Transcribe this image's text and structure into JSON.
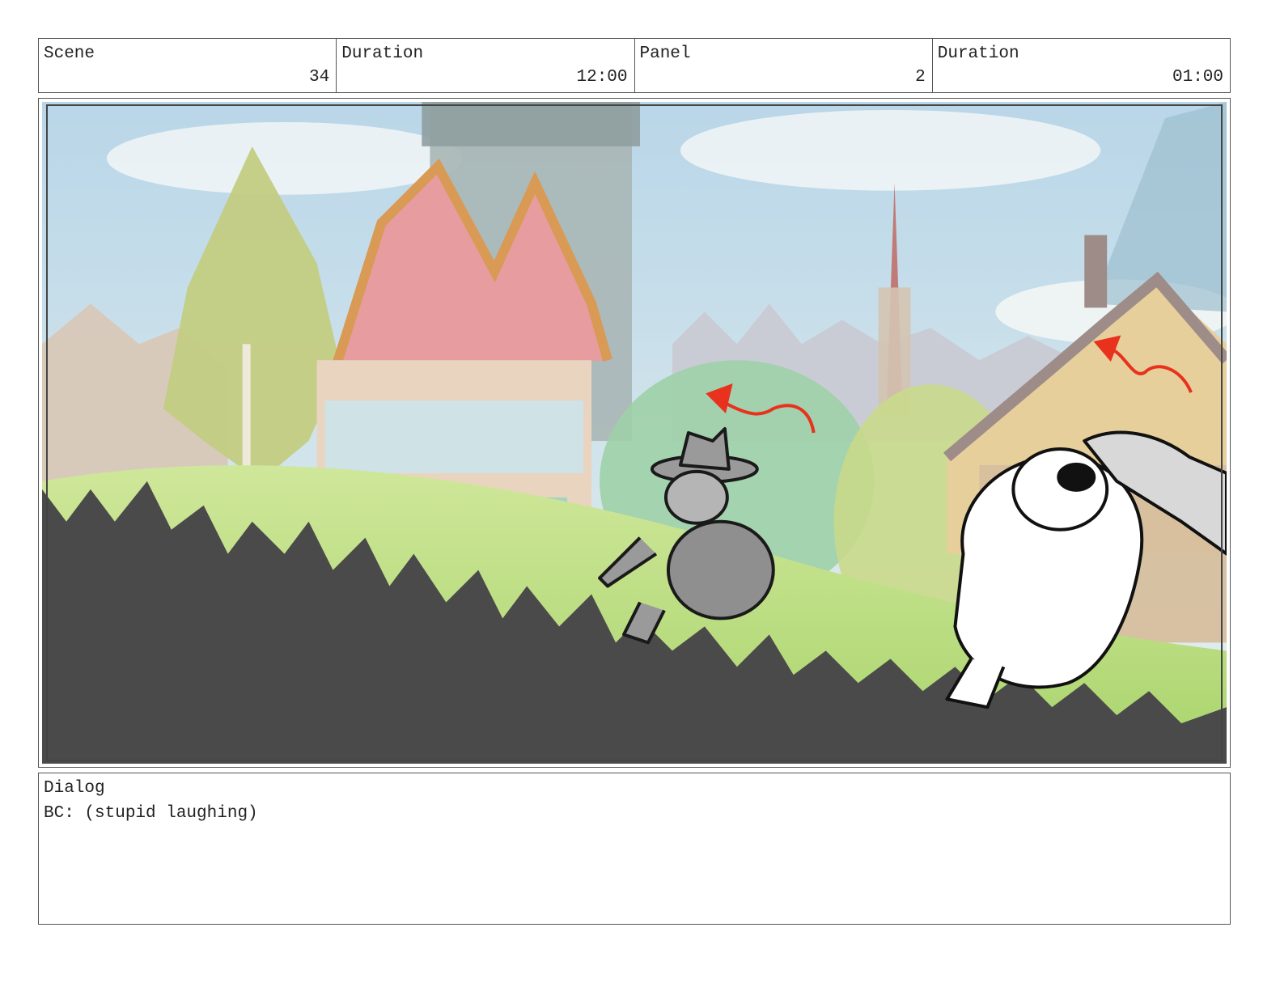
{
  "header": {
    "scene_label": "Scene",
    "scene_value": "34",
    "duration_label": "Duration",
    "duration_value": "12:00",
    "panel_label": "Panel",
    "panel_value": "2",
    "panel_duration_label": "Duration",
    "panel_duration_value": "01:00"
  },
  "panel": {
    "sky_color": "#cfe3ee",
    "grass_color": "#b9dd7f",
    "foreground_color": "#4a4a4a",
    "arrow_color": "#e8321e"
  },
  "dialog": {
    "label": "Dialog",
    "text": "BC: (stupid laughing)"
  }
}
